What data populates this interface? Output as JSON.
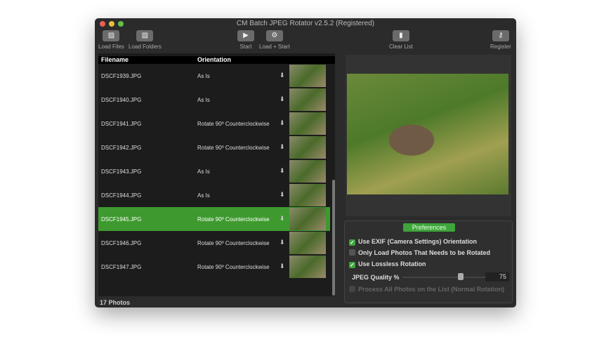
{
  "window": {
    "title": "CM Batch JPEG Rotator v2.5.2 (Registered)"
  },
  "toolbar": {
    "load_files": "Load Files",
    "load_folders": "Load Folders",
    "start": "Start",
    "load_start": "Load + Start",
    "clear_list": "Clear List",
    "register": "Register"
  },
  "list": {
    "headers": {
      "filename": "Filename",
      "orientation": "Orientation"
    },
    "rows": [
      {
        "file": "DSCF1939.JPG",
        "orientation": "As Is"
      },
      {
        "file": "DSCF1940.JPG",
        "orientation": "As Is"
      },
      {
        "file": "DSCF1941.JPG",
        "orientation": "Rotate 90º Counterclockwise"
      },
      {
        "file": "DSCF1942.JPG",
        "orientation": "Rotate 90º Counterclockwise"
      },
      {
        "file": "DSCF1943.JPG",
        "orientation": "As Is"
      },
      {
        "file": "DSCF1944.JPG",
        "orientation": "As Is"
      },
      {
        "file": "DSCF1945.JPG",
        "orientation": "Rotate 90º Counterclockwise",
        "selected": true
      },
      {
        "file": "DSCF1946.JPG",
        "orientation": "Rotate 90º Counterclockwise"
      },
      {
        "file": "DSCF1947.JPG",
        "orientation": "Rotate 90º Counterclockwise"
      }
    ],
    "status": "17 Photos"
  },
  "prefs": {
    "title": "Preferences",
    "use_exif": {
      "label": "Use EXIF (Camera Settings) Orientation",
      "checked": true
    },
    "only_load": {
      "label": "Only Load Photos That Needs to be Rotated",
      "checked": false
    },
    "lossless": {
      "label": "Use Lossless Rotation",
      "checked": true
    },
    "quality_label": "JPEG Quality %",
    "quality": "75",
    "process_all": {
      "label": "Process All Photos on the List (Normal Rotation)",
      "checked": false,
      "disabled": true
    }
  },
  "colors": {
    "accent": "#3e9a2f"
  }
}
